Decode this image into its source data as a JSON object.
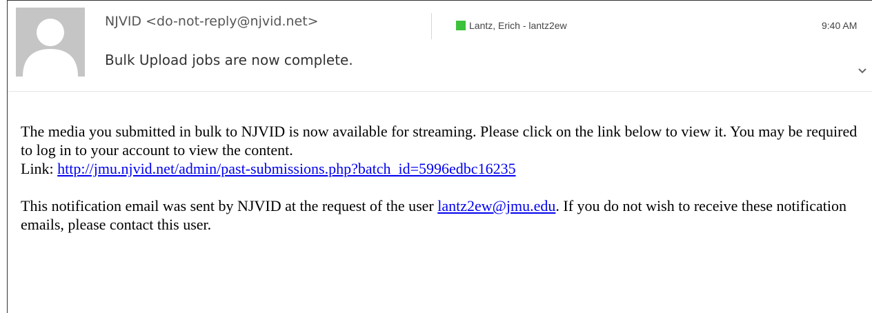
{
  "header": {
    "sender": "NJVID <do-not-reply@njvid.net>",
    "recipient": "Lantz, Erich - lantz2ew",
    "recipient_color": "#3cc13c",
    "time": "9:40 AM",
    "subject": "Bulk Upload jobs are now complete.",
    "avatar_icon": "person-silhouette-icon",
    "expand_icon": "chevron-down-icon"
  },
  "body": {
    "p1_text": "The media you submitted in bulk to NJVID is now available for streaming. Please click on the link below to view it. You may be required to log in to your account to view the content.",
    "p1_link_prefix": "Link: ",
    "p1_link": "http://jmu.njvid.net/admin/past-submissions.php?batch_id=5996edbc16235",
    "p2_before": "This notification email was sent by NJVID at the request of the user ",
    "p2_link": "lantz2ew@jmu.edu",
    "p2_after": ". If you do not wish to receive these notification emails, please contact this user."
  }
}
